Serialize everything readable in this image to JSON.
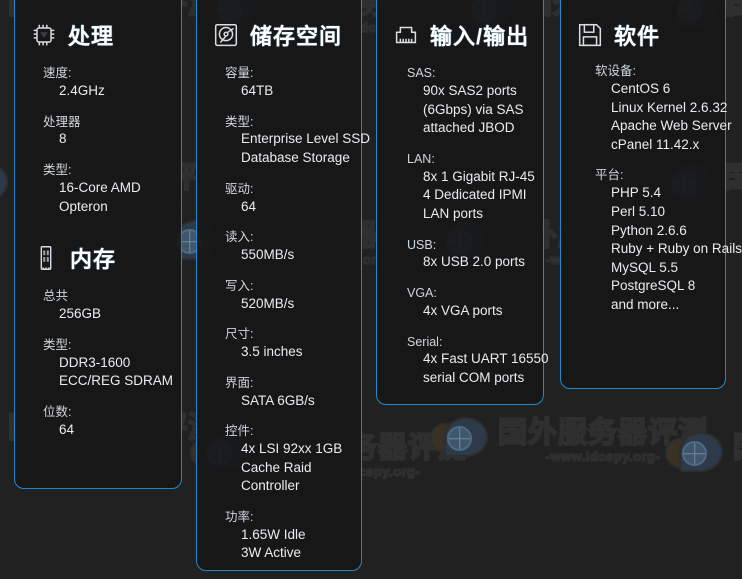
{
  "watermark": {
    "chinese": "国外服务器评测",
    "url": "-www.idcspy.org-"
  },
  "panels": [
    {
      "id": "processor",
      "icon": "cpu-chip-icon",
      "title": "处理",
      "specs": [
        {
          "label": "速度:",
          "values": [
            "2.4GHz"
          ]
        },
        {
          "label": "处理器",
          "values": [
            "8"
          ]
        },
        {
          "label": "类型:",
          "values": [
            "16-Core AMD",
            "Opteron"
          ]
        }
      ],
      "sub_section": {
        "id": "memory",
        "icon": "ram-stick-icon",
        "title": "内存",
        "specs": [
          {
            "label": "总共",
            "values": [
              "256GB"
            ]
          },
          {
            "label": "类型:",
            "values": [
              "DDR3-1600",
              "ECC/REG SDRAM"
            ]
          },
          {
            "label": "位数:",
            "values": [
              "64"
            ]
          }
        ]
      }
    },
    {
      "id": "storage",
      "icon": "hard-disk-icon",
      "title": "储存空间",
      "specs": [
        {
          "label": "容量:",
          "values": [
            "64TB"
          ]
        },
        {
          "label": "类型:",
          "values": [
            "Enterprise Level SSD",
            "Database Storage"
          ]
        },
        {
          "label": "驱动:",
          "values": [
            "64"
          ]
        },
        {
          "label": "读入:",
          "values": [
            "550MB/s"
          ]
        },
        {
          "label": "写入:",
          "values": [
            "520MB/s"
          ]
        },
        {
          "label": "尺寸:",
          "values": [
            "3.5 inches"
          ]
        },
        {
          "label": "界面:",
          "values": [
            "SATA 6GB/s"
          ]
        },
        {
          "label": "控件:",
          "values": [
            "4x LSI 92xx 1GB",
            "Cache Raid",
            "Controller"
          ]
        },
        {
          "label": "功率:",
          "values": [
            "1.65W Idle",
            "3W Active"
          ]
        }
      ]
    },
    {
      "id": "io",
      "icon": "rj45-port-icon",
      "title": "输入/输出",
      "specs": [
        {
          "label": "SAS:",
          "values": [
            "90x SAS2 ports",
            "(6Gbps) via SAS",
            "attached JBOD"
          ]
        },
        {
          "label": "LAN:",
          "values": [
            "8x 1 Gigabit RJ-45",
            "4 Dedicated IPMI",
            "LAN ports"
          ]
        },
        {
          "label": "USB:",
          "values": [
            "8x USB 2.0 ports"
          ]
        },
        {
          "label": "VGA:",
          "values": [
            "4x VGA ports"
          ]
        },
        {
          "label": "Serial:",
          "values": [
            "4x Fast UART 16550",
            "serial COM ports"
          ]
        }
      ]
    },
    {
      "id": "software",
      "icon": "floppy-disk-icon",
      "title": "软件",
      "specs": [
        {
          "label": "软设备:",
          "values": [
            "CentOS 6",
            "Linux Kernel 2.6.32",
            "Apache Web Server",
            "cPanel 11.42.x"
          ]
        },
        {
          "label": "平台:",
          "values": [
            "PHP 5.4",
            "Perl 5.10",
            "Python 2.6.6",
            "Ruby + Ruby on Rails",
            "MySQL 5.5",
            "PostgreSQL 8",
            "and more..."
          ]
        }
      ]
    }
  ],
  "colors": {
    "panel_border": "#2288cc",
    "background": "#212121",
    "panel_bg": "#171717",
    "title_text": "#ffffff",
    "label_text": "#cfd6dd",
    "value_text": "#e9edf1"
  }
}
